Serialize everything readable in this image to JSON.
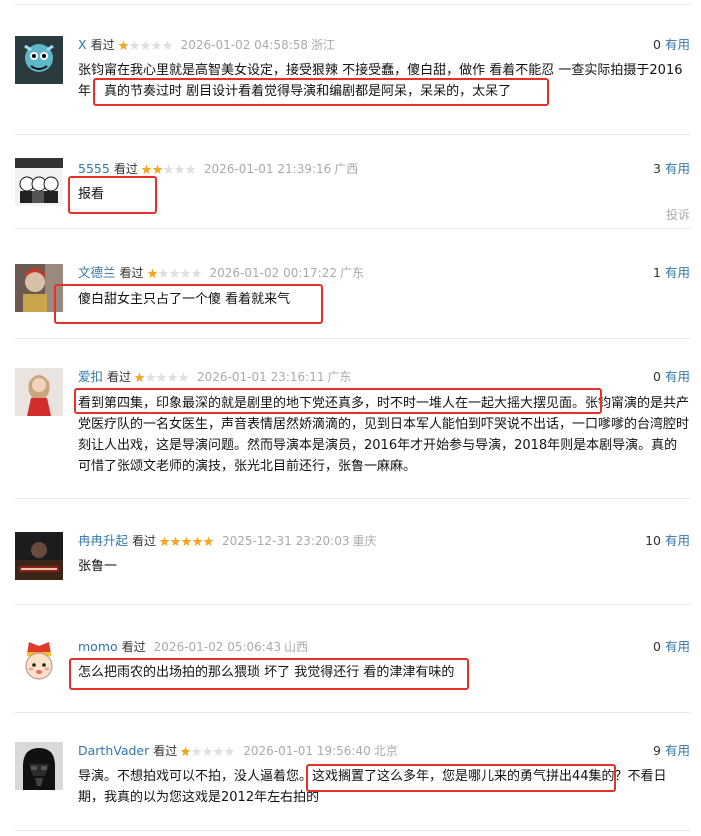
{
  "comments": [
    {
      "user": "X",
      "status": "看过",
      "rating": 1,
      "time": "2026-01-02 04:58:58",
      "location": "浙江",
      "votes": "0",
      "votes_label": "有用",
      "text": "张钧甯在我心里就是高智美女设定，接受狠辣 不接受蠢，傻白甜，做作 看着不能忍 一查实际拍摄于2016年，真的节奏过时 剧目设计看着觉得导演和编剧都是阿呆，呆呆的，太呆了"
    },
    {
      "user": "5555",
      "status": "看过",
      "rating": 2,
      "time": "2026-01-01 21:39:16",
      "location": "广西",
      "votes": "3",
      "votes_label": "有用",
      "text": "报看",
      "report": "投诉"
    },
    {
      "user": "文德兰",
      "status": "看过",
      "rating": 1,
      "time": "2026-01-02 00:17:22",
      "location": "广东",
      "votes": "1",
      "votes_label": "有用",
      "text": "傻白甜女主只占了一个傻 看着就来气"
    },
    {
      "user": "爱扣",
      "status": "看过",
      "rating": 1,
      "time": "2026-01-01 23:16:11",
      "location": "广东",
      "votes": "0",
      "votes_label": "有用",
      "text": "看到第四集，印象最深的就是剧里的地下党还真多，时不时一堆人在一起大摇大摆见面。张钧甯演的是共产党医疗队的一名女医生，声音表情居然娇滴滴的，见到日本军人能怕到吓哭说不出话，一口嗲嗲的台湾腔时刻让人出戏，这是导演问题。然而导演本是演员，2016年才开始参与导演，2018年则是本剧导演。真的可惜了张颂文老师的演技，张光北目前还行，张鲁一麻麻。"
    },
    {
      "user": "冉冉升起",
      "status": "看过",
      "rating": 5,
      "time": "2025-12-31 23:20:03",
      "location": "重庆",
      "votes": "10",
      "votes_label": "有用",
      "text": "张鲁一"
    },
    {
      "user": "momo",
      "status": "看过",
      "rating": 0,
      "time": "2026-01-02 05:06:43",
      "location": "山西",
      "votes": "0",
      "votes_label": "有用",
      "text": "怎么把雨农的出场拍的那么猥琐 坏了 我觉得还行 看的津津有味的"
    },
    {
      "user": "DarthVader",
      "status": "看过",
      "rating": 1,
      "time": "2026-01-01 19:56:40",
      "location": "北京",
      "votes": "9",
      "votes_label": "有用",
      "text": "导演。不想拍戏可以不拍，没人逼着您。这戏搁置了这么多年，您是哪儿来的勇气拼出44集的？不看日期，我真的以为您这戏是2012年左右拍的"
    }
  ],
  "colors": {
    "accent": "#3377aa",
    "star": "#f5a623",
    "highlight": "#e5312a",
    "muted": "#aaaaaa"
  }
}
